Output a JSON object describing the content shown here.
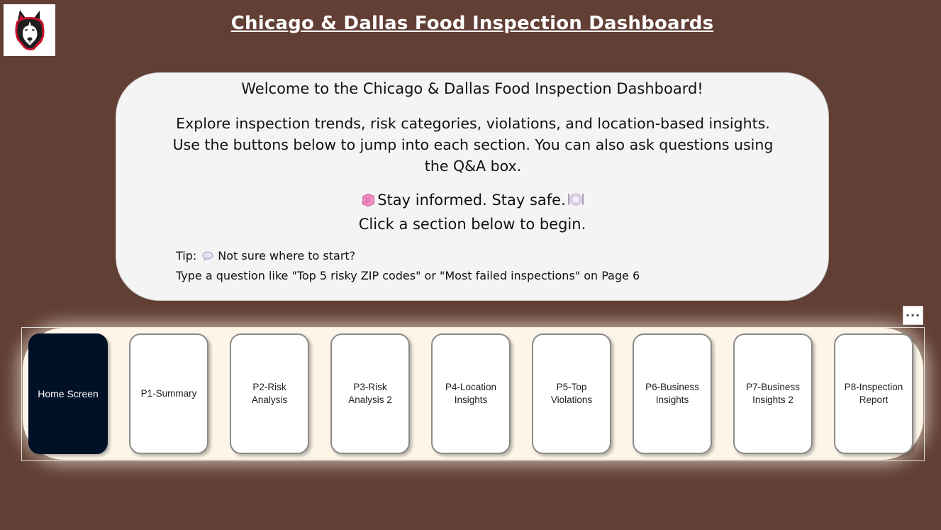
{
  "header": {
    "title": "Chicago & Dallas Food Inspection Dashboards",
    "logo_icon": "husky-logo-icon"
  },
  "welcome": {
    "heading": "Welcome to the Chicago & Dallas Food Inspection Dashboard!",
    "body": "Explore inspection trends, risk categories, violations, and location-based insights. Use the buttons below to jump into each section. You can also ask questions using the Q&A box.",
    "motto": "Stay informed. Stay safe.",
    "motto_icons": [
      "brain-emoji-icon",
      "plate-emoji-icon"
    ],
    "cta": "Click a section below to begin.",
    "tip_label": "Tip:",
    "tip_icon": "speech-bubble-icon",
    "tip_text": "Not sure where to start?",
    "tip_example": "Type a question like \"Top 5 risky ZIP codes\" or \"Most failed inspections\" on Page 6"
  },
  "visual": {
    "more_options_label": "···"
  },
  "nav": {
    "buttons": [
      {
        "label": "Home Screen",
        "active": true
      },
      {
        "label": "P1-Summary"
      },
      {
        "label": "P2-Risk Analysis"
      },
      {
        "label": "P3-Risk Analysis 2"
      },
      {
        "label": "P4-Location Insights"
      },
      {
        "label": "P5-Top Violations"
      },
      {
        "label": "P6-Business Insights"
      },
      {
        "label": "P7-Business Insights 2"
      },
      {
        "label": "P8-Inspection Report"
      }
    ]
  },
  "colors": {
    "background": "#623f35",
    "card": "#f4f4f4",
    "nav_bar": "#fdf6e8",
    "active_button": "#001026"
  }
}
